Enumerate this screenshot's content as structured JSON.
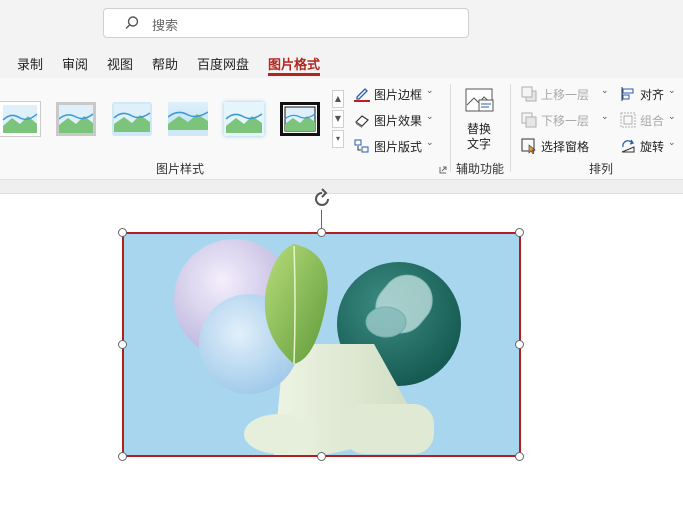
{
  "search": {
    "placeholder": "搜索"
  },
  "tabs": [
    {
      "label": "录制"
    },
    {
      "label": "审阅"
    },
    {
      "label": "视图"
    },
    {
      "label": "帮助"
    },
    {
      "label": "百度网盘"
    },
    {
      "label": "图片格式",
      "active": true
    }
  ],
  "ribbon": {
    "picture_styles": {
      "label": "图片样式",
      "border_label": "图片边框",
      "effects_label": "图片效果",
      "layout_label": "图片版式"
    },
    "accessibility": {
      "label": "辅助功能",
      "alt_text_line1": "替换",
      "alt_text_line2": "文字"
    },
    "arrange": {
      "label": "排列",
      "bring_forward": "上移一层",
      "send_backward": "下移一层",
      "selection_pane": "选择窗格",
      "align": "对齐",
      "group": "组合",
      "rotate": "旋转"
    }
  },
  "colors": {
    "accent": "#b3261e",
    "selection_border": "#b11f1f"
  }
}
